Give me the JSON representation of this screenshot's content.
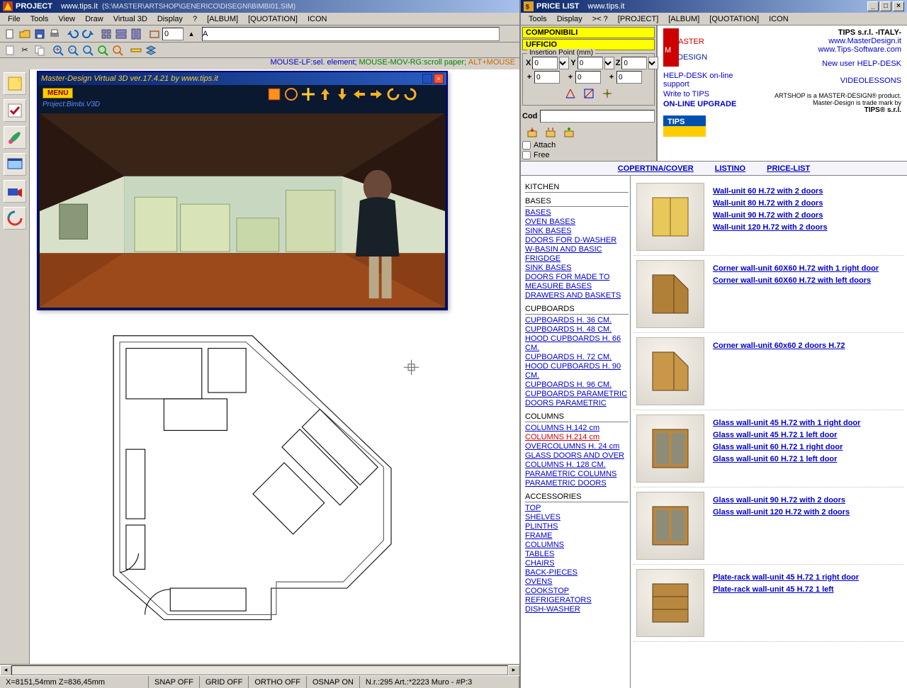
{
  "left": {
    "title_main": "PROJECT",
    "title_sub": "www.tips.it",
    "title_path": "(S:\\MASTER\\ARTSHOP\\GENERICO\\DISEGNI\\BIMBI01.SIM)",
    "menu": [
      "File",
      "Tools",
      "View",
      "Draw",
      "Virtual 3D",
      "Display",
      "?",
      "[ALBUM]",
      "[QUOTATION]",
      "ICON"
    ],
    "dim_value": "0",
    "letter_value": "A",
    "hints": {
      "c1": "MOUSE-LF:sel. element;",
      "c2": "MOUSE-MOV-RG:scroll paper;",
      "c3": "ALT+MOUSE"
    },
    "v3d_title": "Master-Design Virtual 3D ver.17.4.21  by www.tips.it",
    "v3d_menu": "MENU",
    "v3d_project": "Project:Bimbi.V3D",
    "status": {
      "coords": "X=8151,54mm   Z=836,45mm",
      "snap": "SNAP OFF",
      "grid": "GRID OFF",
      "ortho": "ORTHO OFF",
      "osnap": "OSNAP ON",
      "info": "N.r.:295 Art.:*2223 Muro - #P:3"
    }
  },
  "right": {
    "title_main": "PRICE LIST",
    "title_sub": "www.tips.it",
    "menu": [
      "Tools",
      "Display",
      ">< ?",
      "[PROJECT]",
      "[ALBUM]",
      "[QUOTATION]",
      "ICON"
    ],
    "tabs": {
      "t1": "COMPONIBILI",
      "t2": "UFFICIO"
    },
    "fieldset_legend": "Insertion Point (mm)",
    "xyz": {
      "xl": "X",
      "yl": "Y",
      "zl": "Z",
      "x": "0",
      "y": "0",
      "z": "0",
      "dx": "0",
      "dy": "0",
      "dz": "0",
      "plus": "+"
    },
    "cod_label": "Cod",
    "cod_value": "",
    "chk_attach": "Attach",
    "chk_free": "Free",
    "company": {
      "brand_top": "MASTER",
      "brand_bot": "DESIGN",
      "name": "TIPS s.r.l. -ITALY-",
      "url1": "www.MasterDesign.it",
      "url2": "www.Tips-Software.com",
      "help": "HELP-DESK on-line support",
      "newuser": "New user HELP-DESK",
      "write": "Write to TIPS",
      "upgrade": "ON-LINE UPGRADE",
      "video": "VIDEOLESSONS",
      "prod1": "ARTSHOP is a MASTER-DESIGN® product.",
      "prod2": "Master-Design is trade mark by",
      "prod3": "TIPS® s.r.l."
    },
    "cat_tabs": {
      "a": "COPERTINA/COVER",
      "b": "LISTINO",
      "c": "PRICE-LIST"
    },
    "nav_sections": [
      {
        "header": "KITCHEN",
        "links": []
      },
      {
        "header": "BASES",
        "links": [
          "BASES",
          "OVEN BASES",
          "SINK BASES",
          "DOORS FOR D-WASHER",
          "W-BASIN AND BASIC FRIGDGE",
          "SINK BASES",
          "DOORS FOR MADE TO MEASURE BASES",
          "DRAWERS AND BASKETS"
        ]
      },
      {
        "header": "CUPBOARDS",
        "links": [
          "CUPBOARDS H. 36 CM.",
          "CUPBOARDS H. 48 CM.",
          "HOOD CUPBOARDS H. 66 CM.",
          "CUPBOARDS H. 72 CM.",
          "HOOD CUPBOARDS H. 90 CM.",
          "CUPBOARDS H. 96 CM.",
          "CUPBOARDS PARAMETRIC",
          "DOORS PARAMETRIC"
        ]
      },
      {
        "header": "COLUMNS",
        "links": [
          "COLUMNS H.142 cm",
          "COLUMNS H.214 cm",
          "OVERCOLUMNS H. 24 cm",
          "GLASS DOORS AND OVER COLUMNS H. 128 CM.",
          "PARAMETRIC COLUMNS",
          "PARAMETRIC DOORS"
        ],
        "red_index": 1
      },
      {
        "header": "ACCESSORIES",
        "links": [
          "TOP",
          "SHELVES",
          "PLINTHS",
          "FRAME",
          "COLUMNS",
          "TABLES",
          "CHAIRS",
          "BACK-PIECES",
          "OVENS",
          "COOKSTOP",
          "REFRIGERATORS",
          "DISH-WASHER"
        ]
      }
    ],
    "products": [
      {
        "shape": "flat",
        "links": [
          "Wall-unit 60 H.72 with 2 doors",
          "Wall-unit 80 H.72 with 2 doors",
          "Wall-unit 90 H.72 with 2 doors",
          "Wall-unit 120 H.72 with 2 doors"
        ]
      },
      {
        "shape": "corner",
        "links": [
          "Corner wall-unit 60X60 H.72 with 1 right door",
          "Corner wall-unit 60X60 H.72 with left doors"
        ]
      },
      {
        "shape": "corner2",
        "links": [
          "Corner wall-unit 60x60 2 doors H.72"
        ]
      },
      {
        "shape": "glass",
        "links": [
          "Glass wall-unit 45 H.72 with 1 right door",
          "Glass wall-unit 45 H.72 1 left door",
          "Glass wall-unit 60 H.72 1 right door",
          "Glass wall-unit 60 H.72 1 left door"
        ]
      },
      {
        "shape": "glass2",
        "links": [
          "Glass wall-unit 90 H.72 with 2 doors",
          "Glass wall-unit 120 H.72 with 2 doors"
        ]
      },
      {
        "shape": "rack",
        "links": [
          "Plate-rack wall-unit 45 H.72 1 right door",
          "Plate-rack wall-unit 45 H.72 1 left"
        ]
      }
    ]
  }
}
